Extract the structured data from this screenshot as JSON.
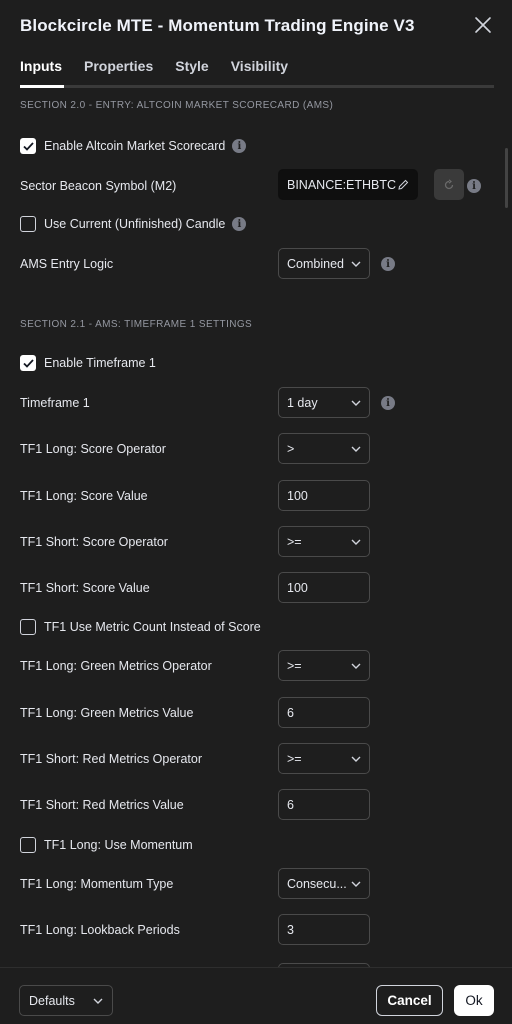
{
  "dialog": {
    "title": "Blockcircle MTE - Momentum Trading Engine V3",
    "close_icon": "close-icon"
  },
  "tabs": [
    {
      "label": "Inputs",
      "active": true
    },
    {
      "label": "Properties",
      "active": false
    },
    {
      "label": "Style",
      "active": false
    },
    {
      "label": "Visibility",
      "active": false
    }
  ],
  "sections": {
    "s20": "SECTION 2.0 - ENTRY: ALTCOIN MARKET SCORECARD (AMS)",
    "s21": "SECTION 2.1 - AMS: TIMEFRAME 1 SETTINGS"
  },
  "inputs": {
    "enable_ams": {
      "label": "Enable Altcoin Market Scorecard",
      "checked": true
    },
    "sector_beacon": {
      "label": "Sector Beacon Symbol (M2)",
      "value": "BINANCE:ETHBTC"
    },
    "use_current_candle": {
      "label": "Use Current (Unfinished) Candle",
      "checked": false
    },
    "ams_entry_logic": {
      "label": "AMS Entry Logic",
      "value": "Combined"
    },
    "enable_tf1": {
      "label": "Enable Timeframe 1",
      "checked": true
    },
    "timeframe1": {
      "label": "Timeframe 1",
      "value": "1 day"
    },
    "tf1_long_score_op": {
      "label": "TF1 Long: Score Operator",
      "value": ">"
    },
    "tf1_long_score_val": {
      "label": "TF1 Long: Score Value",
      "value": "100"
    },
    "tf1_short_score_op": {
      "label": "TF1 Short: Score Operator",
      "value": ">="
    },
    "tf1_short_score_val": {
      "label": "TF1 Short: Score Value",
      "value": "100"
    },
    "tf1_metric_count": {
      "label": "TF1 Use Metric Count Instead of Score",
      "checked": false
    },
    "tf1_long_green_op": {
      "label": "TF1 Long: Green Metrics Operator",
      "value": ">="
    },
    "tf1_long_green_val": {
      "label": "TF1 Long: Green Metrics Value",
      "value": "6"
    },
    "tf1_short_red_op": {
      "label": "TF1 Short: Red Metrics Operator",
      "value": ">="
    },
    "tf1_short_red_val": {
      "label": "TF1 Short: Red Metrics Value",
      "value": "6"
    },
    "tf1_long_momentum": {
      "label": "TF1 Long: Use Momentum",
      "checked": false
    },
    "tf1_long_momentum_type": {
      "label": "TF1 Long: Momentum Type",
      "value": "Consecu..."
    },
    "tf1_long_lookback": {
      "label": "TF1 Long: Lookback Periods",
      "value": "3"
    }
  },
  "footer": {
    "defaults_label": "Defaults",
    "cancel_label": "Cancel",
    "ok_label": "Ok"
  },
  "colors": {
    "background": "#1e1e1e",
    "checkbox_on": "#ffffff",
    "info_icon": "#787b86",
    "field_border": "#4a4a4a"
  }
}
